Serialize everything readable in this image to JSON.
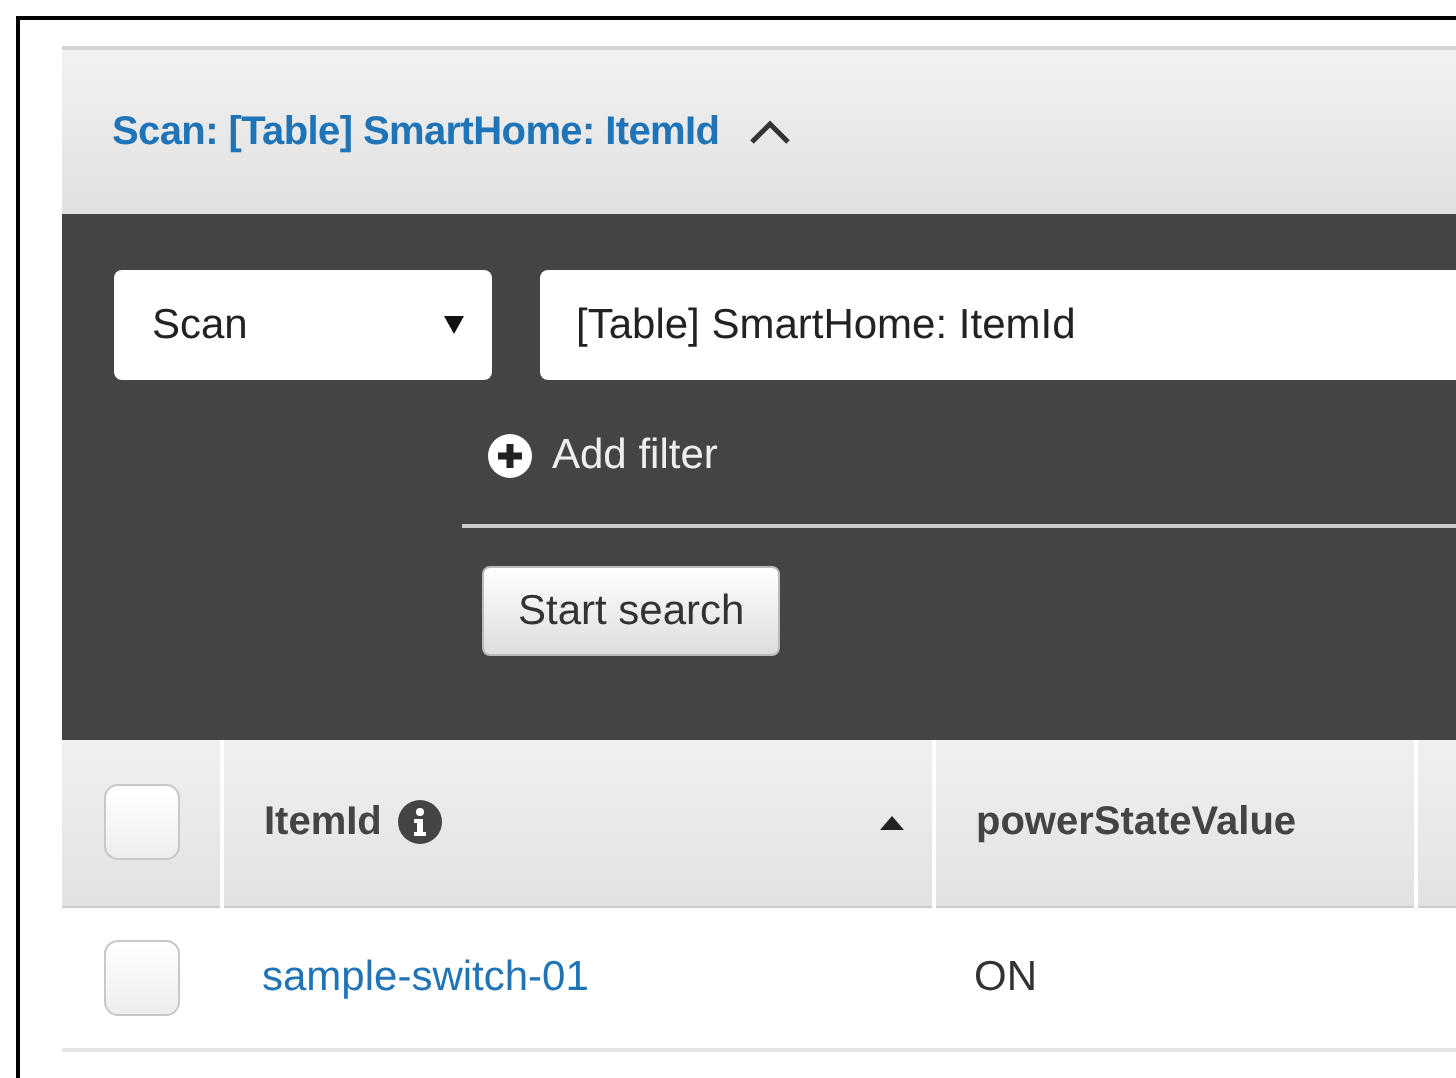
{
  "panel": {
    "title": "Scan: [Table] SmartHome: ItemId",
    "expanded": true
  },
  "query": {
    "mode": "Scan",
    "target": "[Table] SmartHome: ItemId",
    "add_filter": "Add filter",
    "start_button": "Start search"
  },
  "table": {
    "header_checked": false,
    "columns": [
      {
        "label": "ItemId",
        "info": true,
        "sorted": true
      },
      {
        "label": "powerStateValue",
        "info": false,
        "sorted": false
      }
    ],
    "rows": [
      {
        "checked": false,
        "cells": [
          "sample-switch-01",
          "ON"
        ]
      }
    ]
  }
}
